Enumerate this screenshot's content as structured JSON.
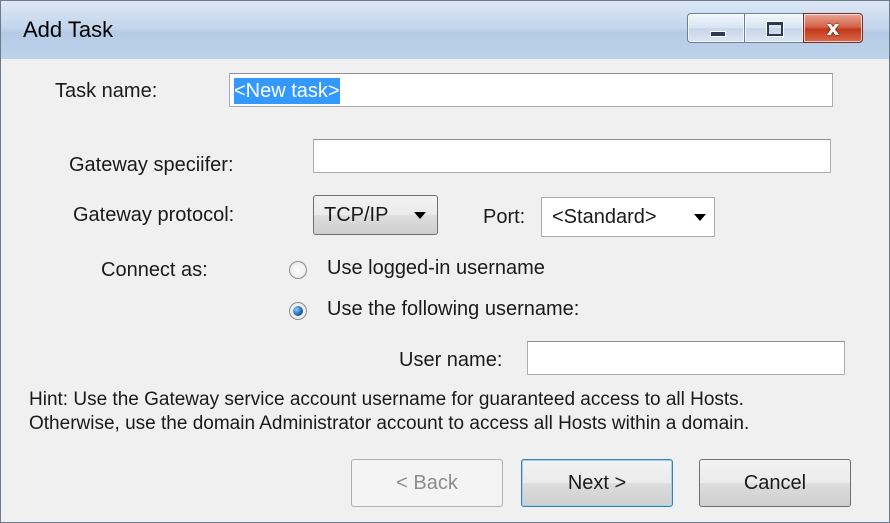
{
  "window": {
    "title": "Add Task",
    "close_glyph": "x"
  },
  "form": {
    "task_name_label": "Task name:",
    "task_name_value": "<New task>",
    "gateway_specifier_label": "Gateway speciifer:",
    "gateway_specifier_value": "",
    "gateway_protocol_label": "Gateway protocol:",
    "gateway_protocol_value": "TCP/IP",
    "port_label": "Port:",
    "port_value": "<Standard>",
    "connect_as_label": "Connect as:",
    "radio_logged_in_label": "Use logged-in username",
    "radio_following_label": "Use the following username:",
    "selected_radio": "following",
    "user_name_label": "User name:",
    "user_name_value": ""
  },
  "hint": {
    "line1": "Hint: Use the Gateway service account username for guaranteed access to all Hosts.",
    "line2": "Otherwise, use the domain Administrator account to access all Hosts within a domain."
  },
  "buttons": {
    "back_label": "< Back",
    "next_label": "Next >",
    "cancel_label": "Cancel"
  },
  "colors": {
    "selection": "#3399ff",
    "close_button": "#c2391b",
    "default_button_border": "#3c7fb1"
  },
  "icons": {
    "minimize": "minimize-icon",
    "maximize": "maximize-icon",
    "close": "close-icon",
    "dropdown": "chevron-down-icon"
  }
}
